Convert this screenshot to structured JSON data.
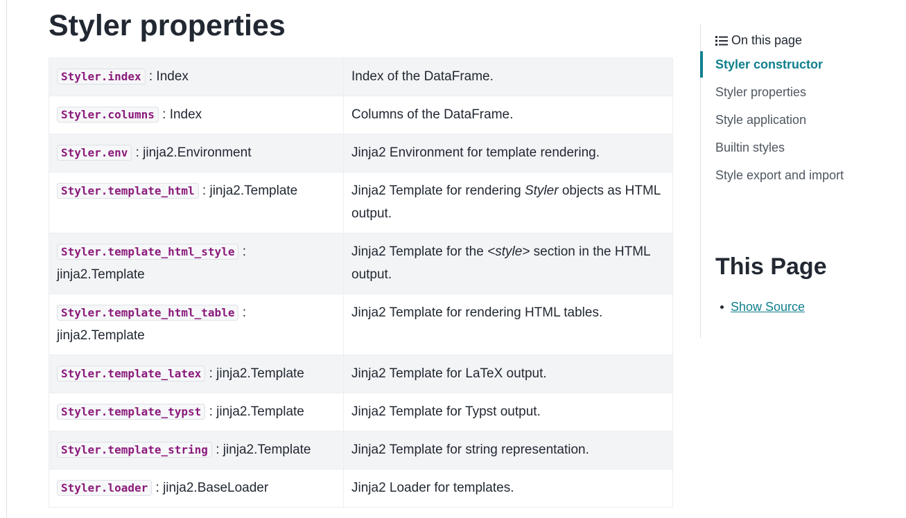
{
  "page": {
    "title": "Styler properties"
  },
  "properties": [
    {
      "name": "Styler.index",
      "type": " : Index",
      "desc_parts": [
        {
          "text": "Index of the DataFrame.",
          "em": false
        }
      ]
    },
    {
      "name": "Styler.columns",
      "type": " : Index",
      "desc_parts": [
        {
          "text": "Columns of the DataFrame.",
          "em": false
        }
      ]
    },
    {
      "name": "Styler.env",
      "type": " : jinja2.Environment",
      "desc_parts": [
        {
          "text": "Jinja2 Environment for template rendering.",
          "em": false
        }
      ]
    },
    {
      "name": "Styler.template_html",
      "type": " : jinja2.Template",
      "desc_parts": [
        {
          "text": "Jinja2 Template for rendering ",
          "em": false
        },
        {
          "text": "Styler",
          "em": true
        },
        {
          "text": " objects as HTML output.",
          "em": false
        }
      ]
    },
    {
      "name": "Styler.template_html_style",
      "type": " : jinja2.Template",
      "desc_parts": [
        {
          "text": "Jinja2 Template for the ",
          "em": false
        },
        {
          "text": "<style>",
          "em": true
        },
        {
          "text": " section in the HTML output.",
          "em": false
        }
      ]
    },
    {
      "name": "Styler.template_html_table",
      "type": " : jinja2.Template",
      "desc_parts": [
        {
          "text": "Jinja2 Template for rendering HTML tables.",
          "em": false
        }
      ]
    },
    {
      "name": "Styler.template_latex",
      "type": " : jinja2.Template",
      "desc_parts": [
        {
          "text": "Jinja2 Template for LaTeX output.",
          "em": false
        }
      ]
    },
    {
      "name": "Styler.template_typst",
      "type": " : jinja2.Template",
      "desc_parts": [
        {
          "text": "Jinja2 Template for Typst output.",
          "em": false
        }
      ]
    },
    {
      "name": "Styler.template_string",
      "type": " : jinja2.Template",
      "desc_parts": [
        {
          "text": "Jinja2 Template for string representation.",
          "em": false
        }
      ]
    },
    {
      "name": "Styler.loader",
      "type": " : jinja2.BaseLoader",
      "desc_parts": [
        {
          "text": "Jinja2 Loader for templates.",
          "em": false
        }
      ]
    }
  ],
  "toc": {
    "header": "On this page",
    "icon": "list-icon",
    "items": [
      {
        "label": "Styler constructor",
        "active": true
      },
      {
        "label": "Styler properties",
        "active": false
      },
      {
        "label": "Style application",
        "active": false
      },
      {
        "label": "Builtin styles",
        "active": false
      },
      {
        "label": "Style export and import",
        "active": false
      }
    ]
  },
  "this_page": {
    "title": "This Page",
    "links": [
      {
        "label": "Show Source"
      }
    ]
  },
  "colors": {
    "accent": "#0f7f8c",
    "code_text": "#8b1a7a",
    "row_stripe": "#f3f4f6"
  }
}
